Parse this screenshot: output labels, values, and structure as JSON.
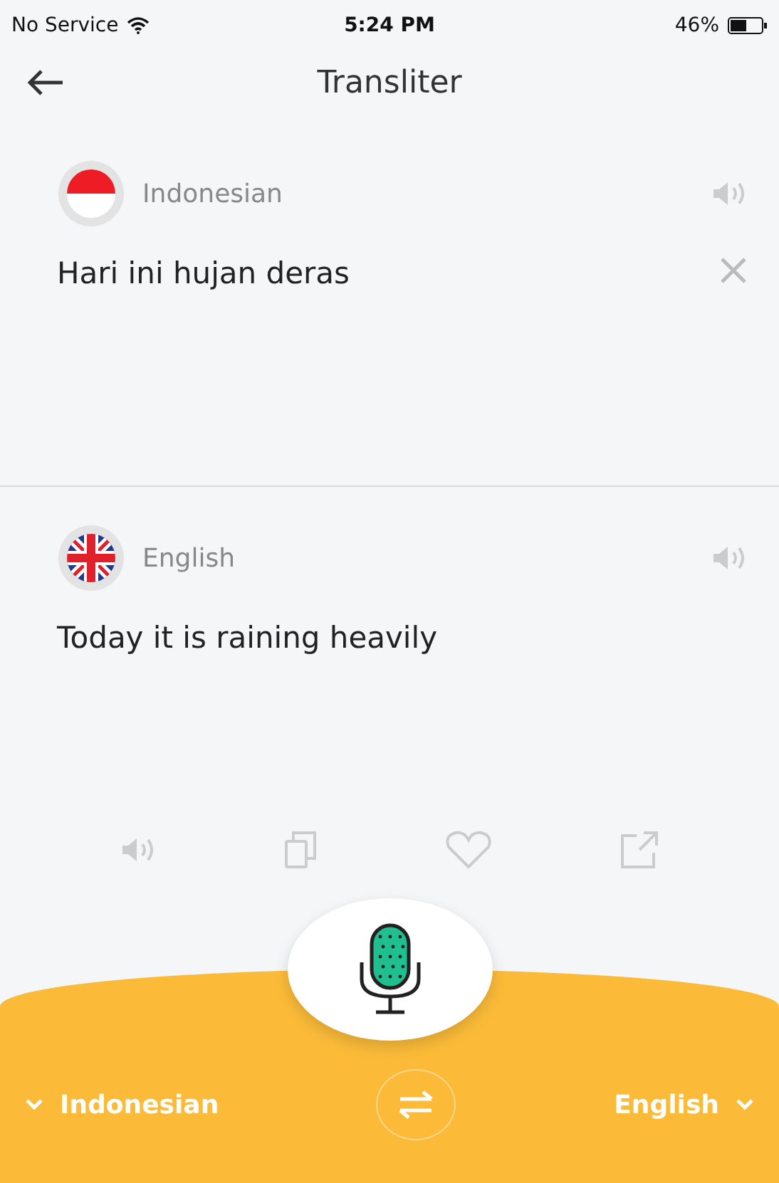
{
  "status_bar": {
    "carrier": "No Service",
    "time": "5:24 PM",
    "battery": "46%"
  },
  "header": {
    "title": "Transliter"
  },
  "panels": [
    {
      "language": "Indonesian",
      "kind": "id",
      "text": "Hari ini hujan deras",
      "clearable": true
    },
    {
      "language": "English",
      "kind": "uk",
      "text": "Today it is raining heavily",
      "clearable": false
    }
  ],
  "bottom_bar": {
    "source_language": "Indonesian",
    "target_language": "English"
  }
}
